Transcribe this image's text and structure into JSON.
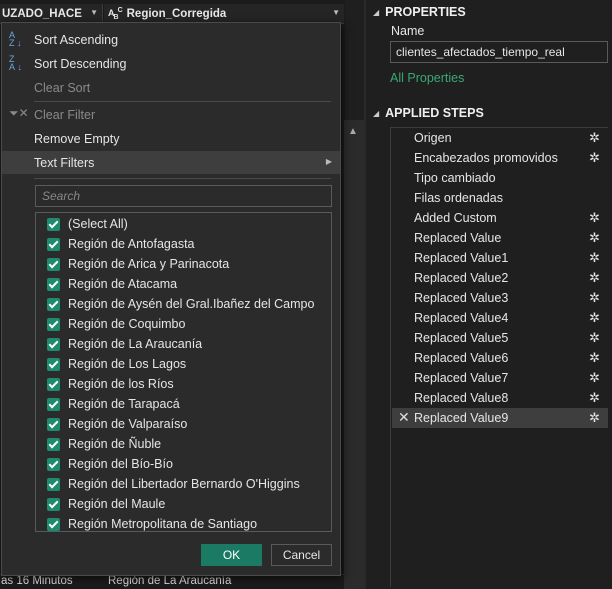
{
  "grid": {
    "col1_header": "UZADO_HACE",
    "col2_type_icon": "ABC",
    "col2_header": "Region_Corregida",
    "last_row": {
      "c1": "as 16 Minutos",
      "c2": "Región de La Araucanía"
    }
  },
  "menu": {
    "sort_asc": "Sort Ascending",
    "sort_desc": "Sort Descending",
    "clear_sort": "Clear Sort",
    "clear_filter": "Clear Filter",
    "remove_empty": "Remove Empty",
    "text_filters": "Text Filters",
    "search_placeholder": "Search",
    "items": [
      "(Select All)",
      "Región de Antofagasta",
      "Región de Arica y Parinacota",
      "Región de Atacama",
      "Región de Aysén del Gral.Ibañez del Campo",
      "Región de Coquimbo",
      "Región de La Araucanía",
      "Región de Los Lagos",
      "Región de los Ríos",
      "Región de Tarapacá",
      "Región de Valparaíso",
      "Región de Ñuble",
      "Región del Bío-Bío",
      "Región del Libertador Bernardo O'Higgins",
      "Región del Maule",
      "Región Metropolitana de Santiago"
    ],
    "ok": "OK",
    "cancel": "Cancel"
  },
  "panel": {
    "properties_title": "PROPERTIES",
    "name_label": "Name",
    "name_value": "clientes_afectados_tiempo_real",
    "all_properties": "All Properties",
    "applied_steps_title": "APPLIED STEPS",
    "steps": [
      {
        "label": "Origen",
        "gear": true
      },
      {
        "label": "Encabezados promovidos",
        "gear": true
      },
      {
        "label": "Tipo cambiado",
        "gear": false
      },
      {
        "label": "Filas ordenadas",
        "gear": false
      },
      {
        "label": "Added Custom",
        "gear": true
      },
      {
        "label": "Replaced Value",
        "gear": true
      },
      {
        "label": "Replaced Value1",
        "gear": true
      },
      {
        "label": "Replaced Value2",
        "gear": true
      },
      {
        "label": "Replaced Value3",
        "gear": true
      },
      {
        "label": "Replaced Value4",
        "gear": true
      },
      {
        "label": "Replaced Value5",
        "gear": true
      },
      {
        "label": "Replaced Value6",
        "gear": true
      },
      {
        "label": "Replaced Value7",
        "gear": true
      },
      {
        "label": "Replaced Value8",
        "gear": true
      },
      {
        "label": "Replaced Value9",
        "gear": true,
        "selected": true
      }
    ]
  },
  "colors": {
    "accent_green": "#1b7a63",
    "checkbox_green": "#1e8a6e",
    "link_green": "#3aa874",
    "highlight": "#3e3e3e"
  }
}
